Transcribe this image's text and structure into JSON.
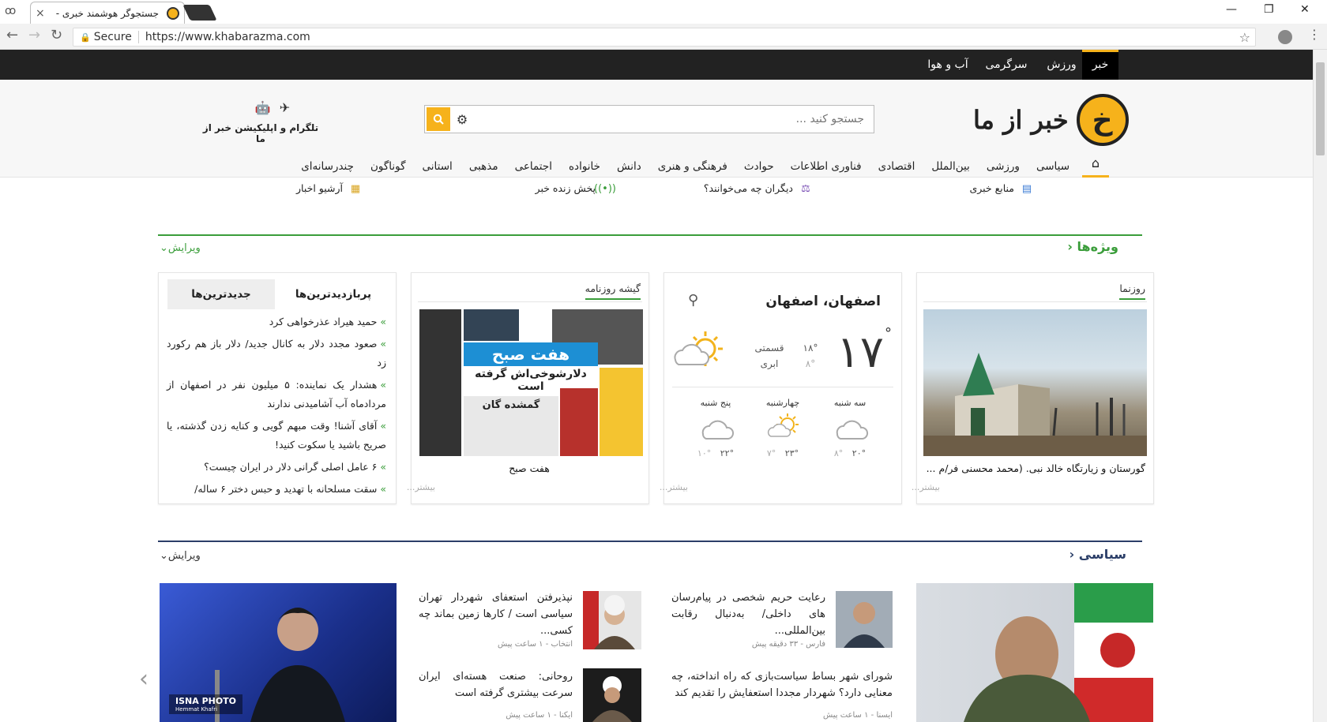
{
  "browser": {
    "tab_title": "جستجوگر هوشمند خبری -",
    "tab_close": "×",
    "secure_label": "Secure",
    "url": "https://www.khabarazma.com",
    "window_min": "—",
    "window_max": "❐",
    "window_close": "✕"
  },
  "topbar": {
    "items": [
      "خبر",
      "ورزش",
      "سرگرمی",
      "آب و هوا"
    ]
  },
  "header": {
    "logo_char": "خ",
    "logo_text": "خبر از ما",
    "search_placeholder": "جستجو کنید ...",
    "app_label": "تلگرام و اپلیکیشن خبر از ما"
  },
  "categories": [
    "سیاسی",
    "ورزشی",
    "بین‌الملل",
    "اقتصادی",
    "فناوری اطلاعات",
    "حوادث",
    "فرهنگی و هنری",
    "دانش",
    "خانواده",
    "اجتماعی",
    "مذهبی",
    "استانی",
    "گوناگون",
    "چندرسانه‌ای"
  ],
  "subnav": {
    "sources": "منابع خبری",
    "others": "دیگران چه می‌خوانند؟",
    "live": "پخش زنده خبر",
    "archive": "آرشیو اخبار"
  },
  "features": {
    "title": "ویژه‌ها",
    "edit": "ویرایش",
    "ruznama_label": "روزنما",
    "ruznama_caption": "گورستان و زیارتگاه خالد نبی. (محمد محسنی فر/م ...",
    "more": "بیشتر...",
    "weather": {
      "city": "اصفهان، اصفهان",
      "temp": "۱۷",
      "degree": "°",
      "high": "۱۸°",
      "low": "۸°",
      "condition_line1": "قسمتی",
      "condition_line2": "ابری",
      "days": [
        {
          "name": "سه شنبه",
          "high": "۲۰°",
          "low": "۸°",
          "icon": "cloud"
        },
        {
          "name": "چهارشنبه",
          "high": "۲۳°",
          "low": "۷°",
          "icon": "sun-cloud"
        },
        {
          "name": "پنج شنبه",
          "high": "۲۲°",
          "low": "۱۰°",
          "icon": "cloud"
        }
      ]
    },
    "kiosk_label": "گیشه روزنامه",
    "kiosk_caption": "هفت صبح",
    "newspaper": {
      "masthead": "هفت صبح",
      "headline": "دلارشوخی‌اش گرفته است",
      "lost": "گمشده گان"
    },
    "tabs": [
      "پربازدیدترین‌ها",
      "جدیدترین‌ها"
    ],
    "news": [
      "حمید هیراد عذرخواهی کرد",
      "صعود مجدد دلار به کانال جدید/ دلار باز هم رکورد زد",
      "هشدار یک نماینده: ۵ میلیون نفر در اصفهان از مردادماه آب آشامیدنی ندارند",
      "آقای آشنا! وقت مبهم گویی و کنایه زدن گذشته، یا صریح باشید یا سکوت کنید!",
      "۶ عامل اصلی گرانی دلار در ایران چیست؟",
      "سقت مسلحانه با تهدید و حبس دختر ۶ ساله/"
    ]
  },
  "politics": {
    "title": "سیاسی",
    "edit": "ویرایش",
    "items": [
      {
        "text": "رعایت حریم شخصی در پیام‌رسان های داخلی/ به‌دنبال رقابت بین‌المللی...",
        "meta": "فارس - ۳۳ دقیقه پیش"
      },
      {
        "text": "شورای شهر بساط سیاست‌بازی که راه انداخته، چه معنایی دارد؟ شهردار مجددا استعفایش را تقدیم کند",
        "meta": "ایسنا - ۱ ساعت پیش"
      },
      {
        "text": "نپذیرفتن استعفای شهردار تهران سیاسی است / کارها زمین بماند چه کسی...",
        "meta": "انتخاب - ۱ ساعت پیش"
      },
      {
        "text": "روحانی: صنعت هسته‌ای ایران سرعت بیشتری گرفته است",
        "meta": "ایکنا - ۱ ساعت پیش"
      }
    ],
    "photo_credit": "ISNA PHOTO",
    "photo_credit_sub": "Hemmat Khafri"
  }
}
